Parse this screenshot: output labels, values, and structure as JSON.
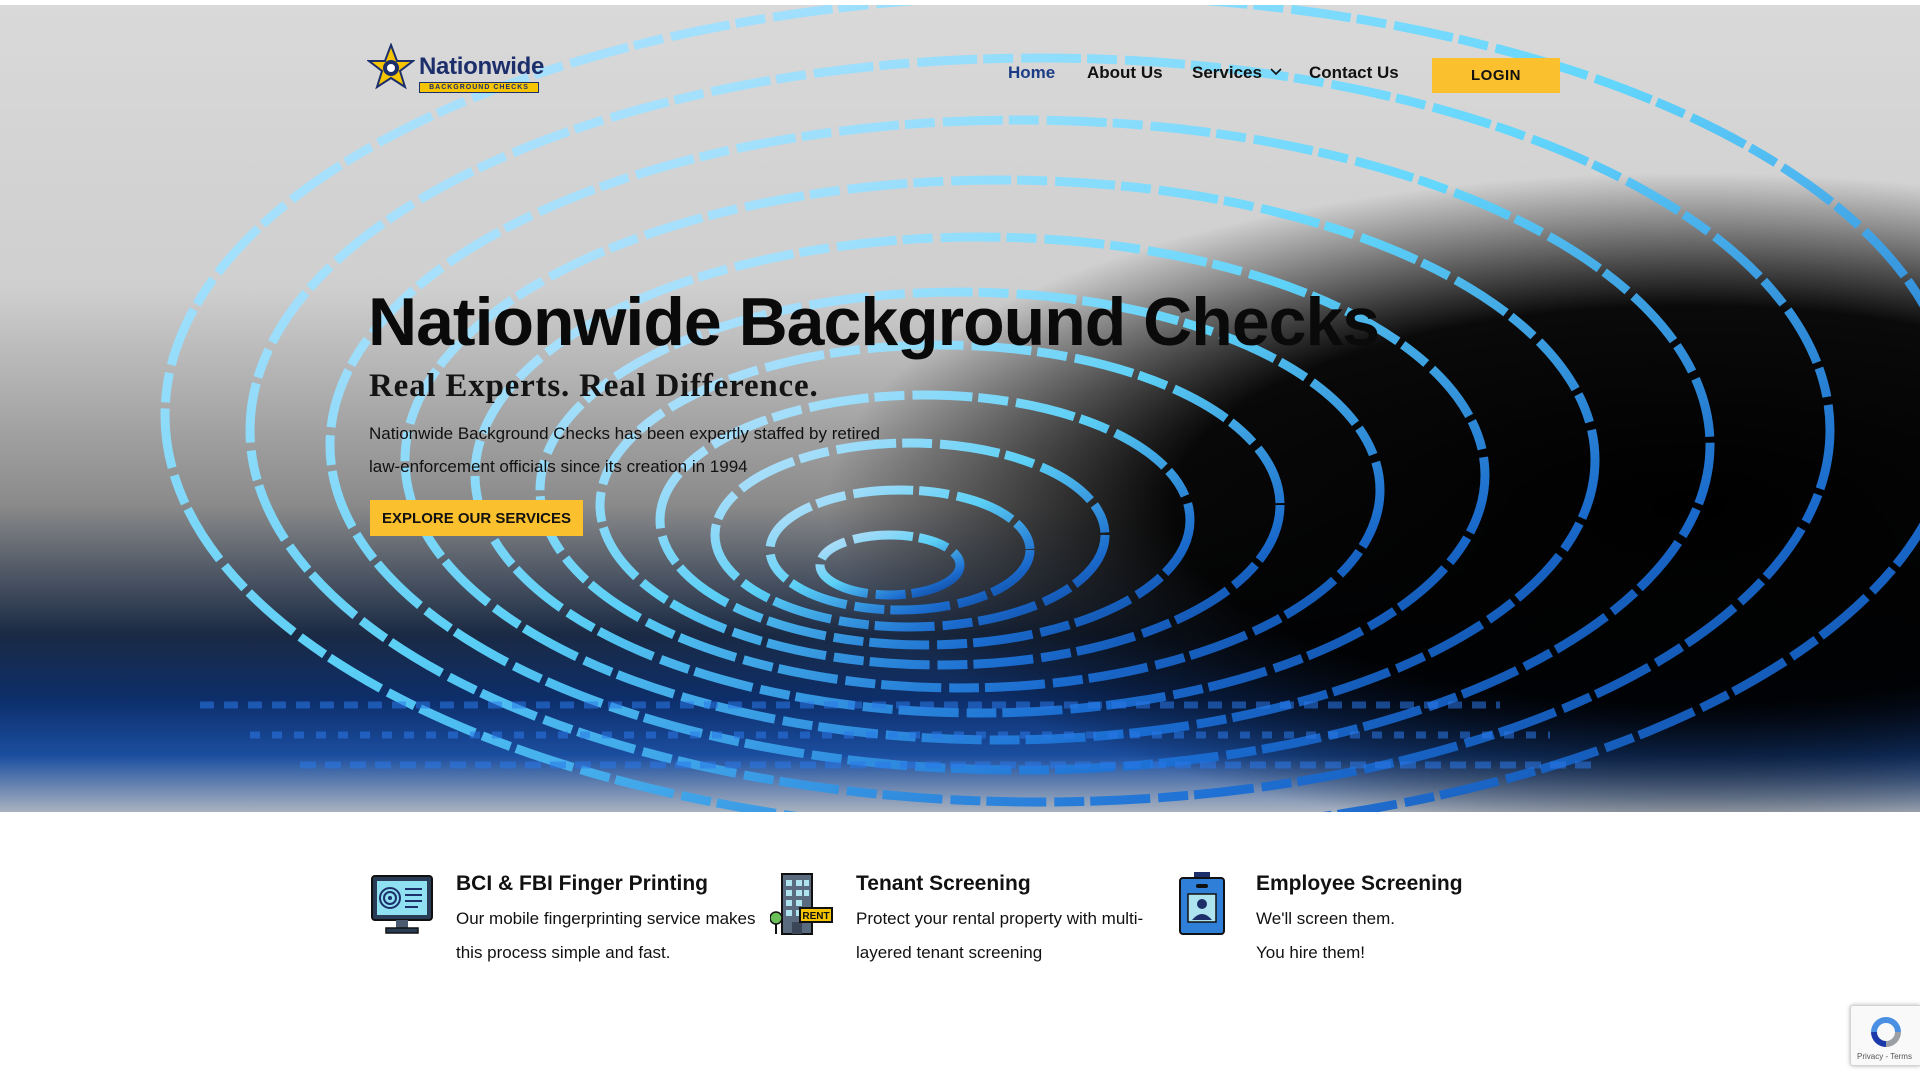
{
  "header": {
    "logo": {
      "word": "Nationwide",
      "tagline": "BACKGROUND CHECKS"
    },
    "nav": [
      {
        "label": "Home",
        "active": true
      },
      {
        "label": "About Us",
        "active": false
      },
      {
        "label": "Services",
        "active": false,
        "has_dropdown": true
      },
      {
        "label": "Contact Us",
        "active": false
      }
    ],
    "login_label": "LOGIN"
  },
  "hero": {
    "title": "Nationwide Background Checks",
    "subtitle": "Real Experts. Real Difference.",
    "description": "Nationwide Background Checks has been expertly staffed by retired law-enforcement officials since its creation in 1994",
    "cta_label": "EXPLORE OUR SERVICES"
  },
  "services": [
    {
      "icon": "fingerprint-monitor-icon",
      "title": "BCI & FBI Finger Printing",
      "description": "Our mobile fingerprinting service makes this process simple and fast."
    },
    {
      "icon": "rent-building-icon",
      "title": "Tenant Screening",
      "description": "Protect your rental property with multi-layered tenant screening"
    },
    {
      "icon": "id-badge-icon",
      "title": "Employee Screening",
      "description_line1": "We'll screen them.",
      "description_line2": "You hire them!"
    }
  ],
  "recaptcha": {
    "text": "Privacy - Terms"
  },
  "colors": {
    "accent": "#fbc02d",
    "nav_active": "#1d3c86",
    "brand_navy": "#1c2f6b"
  }
}
